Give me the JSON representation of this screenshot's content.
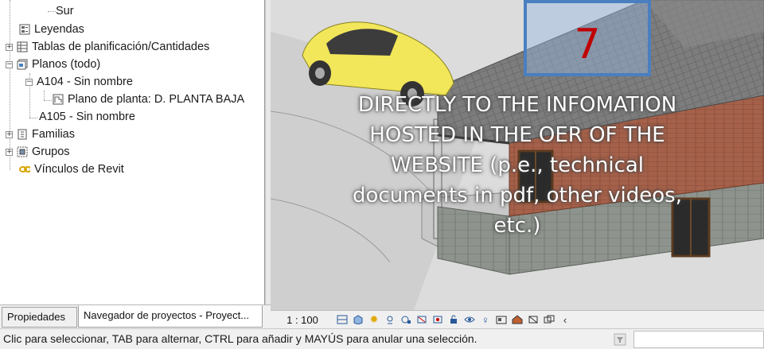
{
  "browser": {
    "items": [
      {
        "label": "Sur"
      },
      {
        "label": "Leyendas"
      },
      {
        "label": "Tablas de planificación/Cantidades"
      },
      {
        "label": "Planos (todo)"
      },
      {
        "label": "A104 - Sin nombre"
      },
      {
        "label": "Plano de planta: D. PLANTA BAJA"
      },
      {
        "label": "A105 - Sin nombre"
      },
      {
        "label": "Familias"
      },
      {
        "label": "Grupos"
      },
      {
        "label": "Vínculos de Revit"
      }
    ]
  },
  "tabs": [
    {
      "label": "Propiedades"
    },
    {
      "label": "Navegador de proyectos - Proyect..."
    }
  ],
  "viewport": {
    "marker_number": "7",
    "overlay_lines": [
      "DIRECTLY TO THE INFOMATION",
      "HOSTED IN THE OER OF THE",
      "WEBSITE (p.e., technical",
      "documents in pdf, other videos,",
      "etc.)"
    ]
  },
  "viewbar": {
    "scale": "1 : 100",
    "icons": [
      "detail-level-icon",
      "visual-style-icon",
      "sun-path-icon",
      "shadows-icon",
      "render-icon",
      "crop-view-icon",
      "show-crop-icon",
      "unlock-view-icon",
      "temporary-hide-icon",
      "reveal-hidden-icon",
      "temporary-properties-icon",
      "worksharing-icon",
      "analytical-model-icon",
      "highlight-displacement-icon",
      "chevron-left-icon"
    ]
  },
  "status": {
    "text": "Clic para seleccionar, TAB para alternar, CTRL para añadir y MAYÚS para anular una selección."
  }
}
